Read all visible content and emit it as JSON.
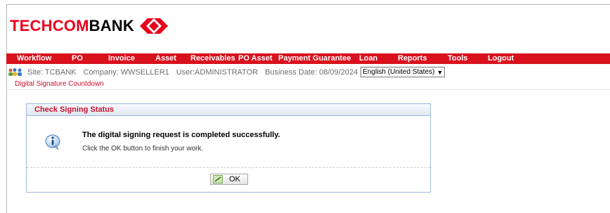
{
  "brand": {
    "part1": "TECHCOM",
    "part2": "BANK"
  },
  "menu": [
    {
      "label": "Workflow",
      "x": 0
    },
    {
      "label": "PO",
      "x": 0
    },
    {
      "label": "Invoice",
      "x": 0
    },
    {
      "label": "Asset",
      "x": 0
    },
    {
      "label": "Receivables",
      "x": 0
    },
    {
      "label": "PO Asset",
      "x": 0
    },
    {
      "label": "Payment Guarantee",
      "x": 0
    },
    {
      "label": "Loan",
      "x": 0
    },
    {
      "label": "Reports",
      "x": 0
    },
    {
      "label": "Tools",
      "x": 0
    },
    {
      "label": "Logout",
      "x": 0
    }
  ],
  "info": {
    "site": "Site: TCBANK",
    "company": "Company: WWSELLER1",
    "user": "User:ADMINISTRATOR",
    "business_date": "Business Date: 08/09/2024",
    "language": "English (United States)"
  },
  "subnav": {
    "link": "Digital Signature Countdown"
  },
  "dialog": {
    "title": "Check Signing Status",
    "message": "The digital signing request is completed successfully.",
    "instruction": "Click the OK button to finish your work.",
    "ok_label": "OK"
  },
  "colors": {
    "brand_red": "#d9111d",
    "panel_border": "#9fb8d6"
  },
  "icons": [
    "users-icon",
    "info-icon",
    "pen-icon",
    "chevron-down-icon",
    "techcombank-logo-icon"
  ]
}
